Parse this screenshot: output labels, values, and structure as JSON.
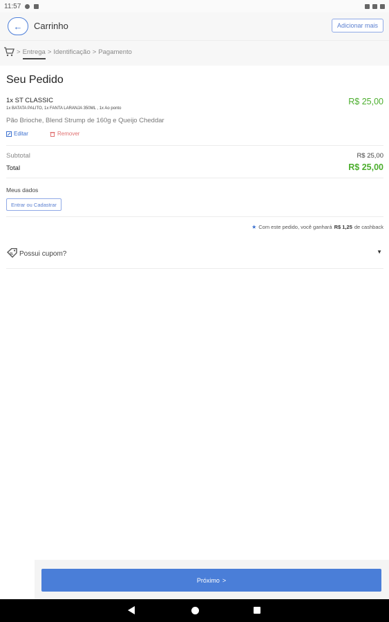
{
  "status_bar": {
    "time": "11:57"
  },
  "header": {
    "title": "Carrinho",
    "add_more_label": "Adicionar mais"
  },
  "breadcrumbs": {
    "sep": ">",
    "items": [
      "Entrega",
      "Identificação",
      "Pagamento"
    ]
  },
  "order": {
    "heading": "Seu Pedido",
    "item": {
      "name": "1x ST CLASSIC",
      "extras": "1x BATATA PALITO, 1x FANTA LARANJA 350ML , 1x Ao ponto",
      "description": "Pão Brioche, Blend Strump de 160g e Queijo Cheddar",
      "price": "R$ 25,00",
      "edit_label": "Editar",
      "remove_label": "Remover"
    },
    "subtotal_label": "Subtotal",
    "subtotal_value": "R$ 25,00",
    "total_label": "Total",
    "total_value": "R$ 25,00"
  },
  "user": {
    "section_label": "Meus dados",
    "login_label": "Entrar ou Cadastrar"
  },
  "cashback": {
    "prefix": "Com este pedido, você ganhará",
    "amount": "R$ 1,25",
    "suffix": "de cashback"
  },
  "coupon": {
    "label": "Possui cupom?"
  },
  "footer": {
    "next_label": "Próximo",
    "next_arrow": ">"
  },
  "colors": {
    "accent": "#4a7ed8",
    "price_green": "#4cae2e",
    "remove_red": "#e07070"
  }
}
